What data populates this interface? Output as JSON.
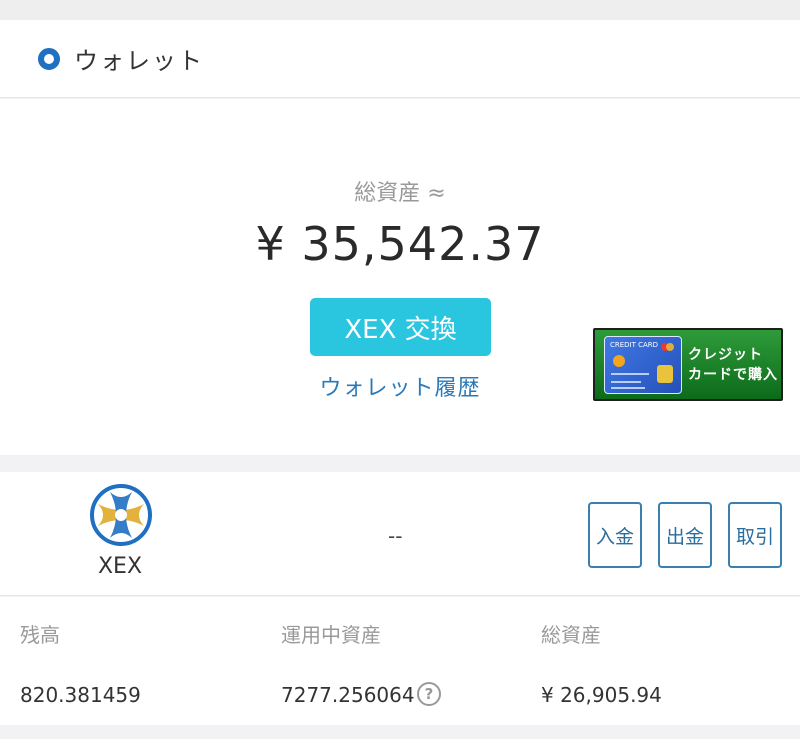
{
  "header": {
    "title": "ウォレット"
  },
  "summary": {
    "total_label": "総資産 ≈",
    "total_amount": "¥ 35,542.37",
    "exchange_button": "XEX 交換",
    "history_link": "ウォレット履歴"
  },
  "banner": {
    "card_title": "CREDIT CARD",
    "line1": "クレジット",
    "line2": "カードで購入"
  },
  "asset": {
    "name": "XEX",
    "placeholder": "--",
    "buttons": {
      "deposit": "入金",
      "withdraw": "出金",
      "trade": "取引"
    }
  },
  "balance": {
    "columns": [
      {
        "label": "残高",
        "value": "820.381459"
      },
      {
        "label": "運用中資産",
        "value": "7277.256064"
      },
      {
        "label": "総資産",
        "value": "¥ 26,905.94"
      }
    ],
    "help_glyph": "?"
  },
  "colors": {
    "accent": "#2ac5de",
    "link": "#2a79b8",
    "brand_blue": "#1f6fc2",
    "button_border": "#3a7fb0"
  }
}
